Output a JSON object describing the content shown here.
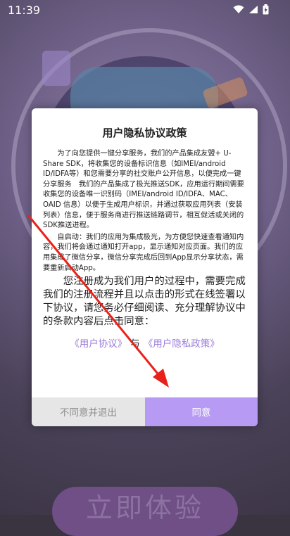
{
  "status_bar": {
    "time": "11:39"
  },
  "background": {
    "bottom_button_label": "立即体验"
  },
  "dialog": {
    "title": "用户隐私协议政策",
    "paragraph1": "为了向您提供一键分享服务，我们的产品集成友盟+ U-Share SDK，将收集您的设备标识信息（如IMEI/android ID/IDFA等）和您需要分享的社交账户公开信息，以便完成一键分享服务　我们的产品集成了极光推送SDK，应用运行期间需要收集您的设备唯一识别码（IMEI/android ID/IDFA、MAC、OAID 信息）以便于生成用户标识，并通过获取应用列表（安装列表）信息，便于服务商进行推送链路调节，相互促活或关闭的SDK推送进程。",
    "paragraph2": "自启动：我们的应用为集成极光，为方便您快速查看通知内容，我们将会通过通知打开app，显示通知对应页面。我们的应用集成了微信分享，微信分享完成后回到App显示分享状态，需要重新启动App。",
    "paragraph3": "您注册成为我们用户的过程中，需要完成我们的注册流程并且以点击的形式在线签署以下协议，请您务必仔细阅读、充分理解协议中的条款内容后点击同意：",
    "link_user_agreement": "《用户协议》",
    "link_and": "与",
    "link_privacy_policy": "《用户隐私政策》",
    "decline_button": "不同意并退出",
    "agree_button": "同意"
  },
  "colors": {
    "accent": "#b79af3",
    "link": "#9a7bd9",
    "annotation_arrow": "#e8221b"
  }
}
